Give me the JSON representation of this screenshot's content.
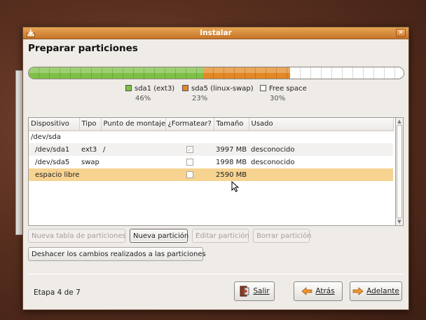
{
  "window": {
    "title": "Instalar",
    "page_title": "Preparar particiones"
  },
  "partition_bar": {
    "segments": [
      {
        "name": "sda1 (ext3)",
        "percent": 46,
        "percent_label": "46%",
        "color": "#7ec045"
      },
      {
        "name": "sda5 (linux-swap)",
        "percent": 23,
        "percent_label": "23%",
        "color": "#e38825"
      },
      {
        "name": "Free space",
        "percent": 30,
        "percent_label": "30%",
        "color": "#ffffff"
      }
    ]
  },
  "table": {
    "columns": [
      "Dispositivo",
      "Tipo",
      "Punto de montaje",
      "¿Formatear?",
      "Tamaño",
      "Usado"
    ],
    "rows": [
      {
        "device": "/dev/sda",
        "type": "",
        "mount": "",
        "format": null,
        "size": "",
        "used": ""
      },
      {
        "device": "/dev/sda1",
        "type": "ext3",
        "mount": "/",
        "format": true,
        "size": "3997 MB",
        "used": "desconocido"
      },
      {
        "device": "/dev/sda5",
        "type": "swap",
        "mount": "",
        "format": false,
        "size": "1998 MB",
        "used": "desconocido"
      },
      {
        "device": "espacio libre",
        "type": "",
        "mount": "",
        "format": false,
        "size": "2590 MB",
        "used": "",
        "selected": true
      }
    ]
  },
  "buttons": {
    "new_table": "Nueva tabla de particiones",
    "new_partition": "Nueva partición",
    "edit_partition": "Editar partición",
    "delete_partition": "Borrar partición",
    "undo": "Deshacer los cambios realizados a las particiones"
  },
  "footer": {
    "stage": "Etapa 4 de 7",
    "quit": "Salir",
    "back": "Atrás",
    "forward": "Adelante"
  },
  "icons": {
    "window": "installer-icon",
    "quit": "quit-icon",
    "back": "arrow-left-icon",
    "forward": "arrow-right-icon"
  }
}
